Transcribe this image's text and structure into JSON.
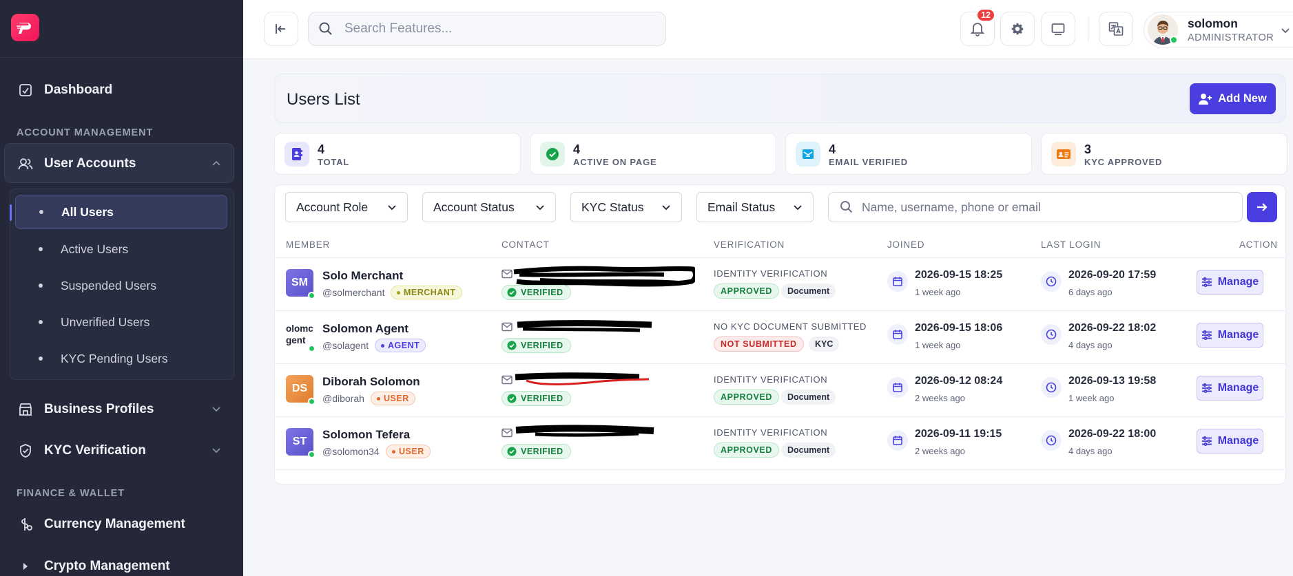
{
  "sidebar": {
    "logo_icon": "p-logo-icon",
    "dashboard": "Dashboard",
    "section_account": "ACCOUNT MANAGEMENT",
    "user_accounts": "User Accounts",
    "sub_items": [
      {
        "label": "All Users",
        "active": true
      },
      {
        "label": "Active Users"
      },
      {
        "label": "Suspended Users"
      },
      {
        "label": "Unverified Users"
      },
      {
        "label": "KYC Pending Users"
      }
    ],
    "business_profiles": "Business Profiles",
    "kyc_verification": "KYC Verification",
    "section_finance": "FINANCE & WALLET",
    "currency_management": "Currency Management",
    "crypto_management": "Crypto Management"
  },
  "topbar": {
    "search_placeholder": "Search Features...",
    "notification_count": "12",
    "user_name": "solomon",
    "user_role": "ADMINISTRATOR"
  },
  "page": {
    "title": "Users List",
    "add_label": "Add New"
  },
  "stats": [
    {
      "value": "4",
      "label": "TOTAL",
      "color": "#4a3ee0"
    },
    {
      "value": "4",
      "label": "ACTIVE ON PAGE",
      "color": "#16a34a"
    },
    {
      "value": "4",
      "label": "EMAIL VERIFIED",
      "color": "#0ea5e9"
    },
    {
      "value": "3",
      "label": "KYC APPROVED",
      "color": "#ea7a12"
    }
  ],
  "filters": {
    "account_role": "Account Role",
    "account_status": "Account Status",
    "kyc_status": "KYC Status",
    "email_status": "Email Status",
    "search_placeholder": "Name, username, phone or email"
  },
  "columns": {
    "member": "MEMBER",
    "contact": "CONTACT",
    "verification": "VERIFICATION",
    "joined": "JOINED",
    "last_login": "LAST LOGIN",
    "action": "ACTION"
  },
  "rows": [
    {
      "initials": "SM",
      "name": "Solo Merchant",
      "username": "@solmerchant",
      "role": "MERCHANT",
      "email_status": "VERIFIED",
      "verification_title": "IDENTITY VERIFICATION",
      "verification_status": "APPROVED",
      "doc_type": "Document",
      "joined": "2026-09-15 18:25",
      "joined_ago": "1 week ago",
      "last_login": "2026-09-20 17:59",
      "last_login_ago": "6 days ago",
      "action": "Manage"
    },
    {
      "initials": "olomc gent",
      "name": "Solomon Agent",
      "username": "@solagent",
      "role": "AGENT",
      "email_status": "VERIFIED",
      "verification_title": "NO KYC DOCUMENT SUBMITTED",
      "verification_status": "NOT SUBMITTED",
      "doc_type": "KYC",
      "joined": "2026-09-15 18:06",
      "joined_ago": "1 week ago",
      "last_login": "2026-09-22 18:02",
      "last_login_ago": "4 days ago",
      "action": "Manage"
    },
    {
      "initials": "DS",
      "name": "Diborah Solomon",
      "username": "@diborah",
      "role": "USER",
      "email_status": "VERIFIED",
      "verification_title": "IDENTITY VERIFICATION",
      "verification_status": "APPROVED",
      "doc_type": "Document",
      "joined": "2026-09-12 08:24",
      "joined_ago": "2 weeks ago",
      "last_login": "2026-09-13 19:58",
      "last_login_ago": "1 week ago",
      "action": "Manage"
    },
    {
      "initials": "ST",
      "name": "Solomon Tefera",
      "username": "@solomon34",
      "role": "USER",
      "email_status": "VERIFIED",
      "verification_title": "IDENTITY VERIFICATION",
      "verification_status": "APPROVED",
      "doc_type": "Document",
      "joined": "2026-09-11 19:15",
      "joined_ago": "2 weeks ago",
      "last_login": "2026-09-22 18:00",
      "last_login_ago": "4 days ago",
      "action": "Manage"
    }
  ]
}
